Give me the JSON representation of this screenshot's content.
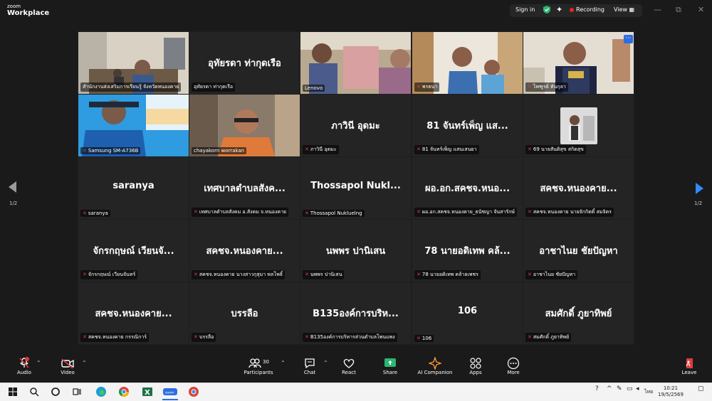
{
  "app": {
    "brand_top": "zoom",
    "brand_bottom": "Workplace"
  },
  "titlebar": {
    "signin": "Sign in",
    "recording": "Recording",
    "view": "View",
    "min": "—",
    "restore": "⧉",
    "close": "✕"
  },
  "gallery": {
    "page_left": "1/2",
    "page_right": "1/2",
    "more": "···",
    "tiles": [
      {
        "name": "",
        "label": "สำนักงานส่งเสริมการเรียนรู้ จังหวัดหนองคาย",
        "video": "office",
        "muted": false,
        "active": true
      },
      {
        "name": "อุทัยรดา ท่ากุดเรือ",
        "label": "อุทัยรดา ท่ากุดเรือ",
        "video": "",
        "muted": false
      },
      {
        "name": "",
        "label": "Lenovo",
        "video": "couple",
        "muted": false
      },
      {
        "name": "",
        "label": "พรธนา",
        "video": "two",
        "muted": true
      },
      {
        "name": "",
        "label": "ไพฑูรย์ หันกุลา",
        "video": "man",
        "muted": true
      },
      {
        "name": "",
        "label": "Samsung SM-A736B",
        "video": "blue",
        "muted": true
      },
      {
        "name": "",
        "label": "chayakorn worrakan",
        "video": "orange",
        "muted": false
      },
      {
        "name": "ภาวินี อุดมะ",
        "label": "ภาวินี อุดมะ",
        "video": "",
        "muted": true
      },
      {
        "name": "81 จันทร์เพ็ญ แส...",
        "label": "81 จันทร์เพ็ญ แสนเสนยา",
        "video": "",
        "muted": true
      },
      {
        "name": "",
        "label": "69 นายสันติสุข สกิดสุข",
        "video": "avatar",
        "muted": true
      },
      {
        "name": "saranya",
        "label": "saranya",
        "video": "",
        "muted": true
      },
      {
        "name": "เทศบาลตำบลสังค...",
        "label": "เทศบาลตำบลสังคม อ.สังคม จ.หนองคาย",
        "video": "",
        "muted": true
      },
      {
        "name": "Thossapol  Nukl...",
        "label": "Thossapol Nukluelng",
        "video": "",
        "muted": true
      },
      {
        "name": "ผอ.อก.สคชจ.หนอ...",
        "label": "ผอ.อก.สคชจ.หนองคาย_ธนัชญา จันสารักษ์",
        "video": "",
        "muted": true
      },
      {
        "name": "สคชจ.หนองคาย...",
        "label": "สคชจ.หนองคาย นายจักกิตติ์ สมจิตร",
        "video": "",
        "muted": true
      },
      {
        "name": "จักรกฤษณ์ เวียนจั...",
        "label": "จักรกฤษณ์ เวียนจันทร์",
        "video": "",
        "muted": true
      },
      {
        "name": "สคชจ.หนองคาย...",
        "label": "สคชจ.หนองคาย นางสาวกุสุมา พลโพธิ์",
        "video": "",
        "muted": true
      },
      {
        "name": "นพพร ปานิเสน",
        "label": "นพพร ปานิเสน",
        "video": "",
        "muted": true
      },
      {
        "name": "78 นายอดิเทพ คล้...",
        "label": "78 นายอดิเทพ คล้ายเพชร",
        "video": "",
        "muted": true
      },
      {
        "name": "อาชาไนย ชัยปัญหา",
        "label": "อาชาไนย ชัยปัญหา",
        "video": "",
        "muted": true
      },
      {
        "name": "สคชจ.หนองคาย...",
        "label": "สคชจ.หนองคาย กรรณิการ์",
        "video": "",
        "muted": true
      },
      {
        "name": "บรรลือ",
        "label": "บรรลือ",
        "video": "",
        "muted": true
      },
      {
        "name": "B135องค์การบริห...",
        "label": "B135องค์การบริหารส่วนตำบลโพนแพง",
        "video": "",
        "muted": true
      },
      {
        "name": "106",
        "label": "106",
        "video": "",
        "muted": true
      },
      {
        "name": "สมศักดิ์ ภูยาทิพย์",
        "label": "สมศักดิ์ ภูยาทิพย์",
        "video": "",
        "muted": true
      }
    ]
  },
  "toolbar": {
    "audio": "Audio",
    "video": "Video",
    "participants": "Participants",
    "participants_count": "30",
    "chat": "Chat",
    "react": "React",
    "share": "Share",
    "ai": "AI Companion",
    "apps": "Apps",
    "more": "More",
    "leave": "Leave"
  },
  "taskbar": {
    "zoom_label": "zoom",
    "lang": "ไทย",
    "time": "10:21",
    "date": "19/5/2569"
  },
  "colors": {
    "accent": "#2d8cff",
    "active_speaker": "#35d66b",
    "mute": "#e03c3c",
    "share": "#2bb673"
  }
}
